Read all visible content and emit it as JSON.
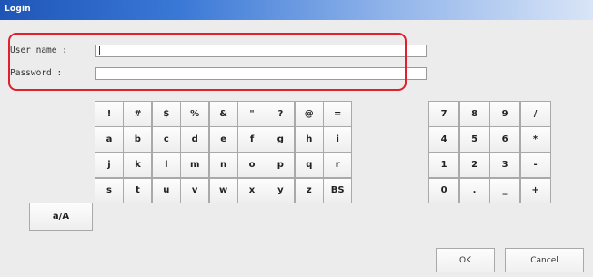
{
  "window": {
    "title": "Login"
  },
  "form": {
    "username_label": "User name :",
    "username_value": "",
    "password_label": "Password :",
    "password_value": ""
  },
  "keyboard": {
    "rows": [
      [
        "!",
        "#",
        "$",
        "%",
        "&",
        "\"",
        "?",
        "@",
        "="
      ],
      [
        "a",
        "b",
        "c",
        "d",
        "e",
        "f",
        "g",
        "h",
        "i"
      ],
      [
        "j",
        "k",
        "l",
        "m",
        "n",
        "o",
        "p",
        "q",
        "r"
      ],
      [
        "s",
        "t",
        "u",
        "v",
        "w",
        "x",
        "y",
        "z",
        "BS"
      ]
    ],
    "toggle_label": "a/A",
    "numpad": [
      [
        "7",
        "8",
        "9",
        "/"
      ],
      [
        "4",
        "5",
        "6",
        "*"
      ],
      [
        "1",
        "2",
        "3",
        "-"
      ],
      [
        "0",
        ".",
        "_",
        "+"
      ]
    ]
  },
  "buttons": {
    "ok": "OK",
    "cancel": "Cancel"
  },
  "colors": {
    "highlight": "#e0202a",
    "title_bar": "#1e56b8"
  }
}
